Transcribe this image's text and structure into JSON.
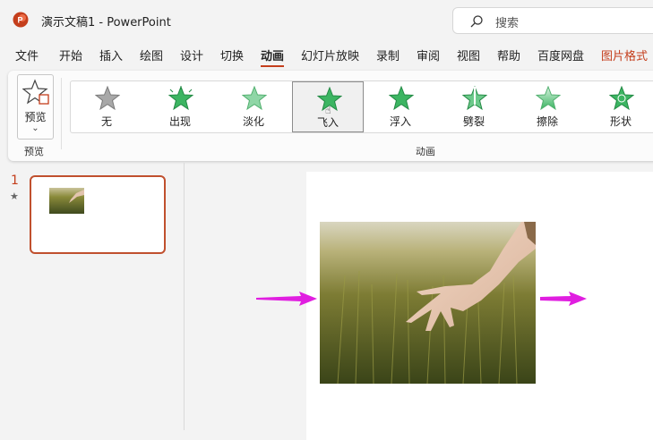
{
  "window": {
    "title": "演示文稿1  -  PowerPoint"
  },
  "app_icon": {
    "letter": "P",
    "color": "#c43e1c"
  },
  "search": {
    "placeholder": "搜索"
  },
  "tabs": [
    {
      "label": "文件"
    },
    {
      "label": "开始"
    },
    {
      "label": "插入"
    },
    {
      "label": "绘图"
    },
    {
      "label": "设计"
    },
    {
      "label": "切换"
    },
    {
      "label": "动画",
      "active": true
    },
    {
      "label": "幻灯片放映"
    },
    {
      "label": "录制"
    },
    {
      "label": "审阅"
    },
    {
      "label": "视图"
    },
    {
      "label": "帮助"
    },
    {
      "label": "百度网盘"
    },
    {
      "label": "图片格式",
      "accent": true
    }
  ],
  "ribbon": {
    "preview": {
      "button_label": "预览",
      "group_label": "预览"
    },
    "animation_group_label": "动画",
    "animations": [
      {
        "label": "无",
        "style": "none"
      },
      {
        "label": "出现",
        "style": "appear"
      },
      {
        "label": "淡化",
        "style": "fade"
      },
      {
        "label": "飞入",
        "style": "flyin",
        "selected": true
      },
      {
        "label": "浮入",
        "style": "float"
      },
      {
        "label": "劈裂",
        "style": "split"
      },
      {
        "label": "擦除",
        "style": "wipe"
      },
      {
        "label": "形状",
        "style": "shape"
      }
    ]
  },
  "slides_pane": {
    "slide_number": "1",
    "animation_marker": "★"
  },
  "colors": {
    "accent": "#c43e1c",
    "arrow": "#e01ee0",
    "star_green": "#3cb562"
  }
}
